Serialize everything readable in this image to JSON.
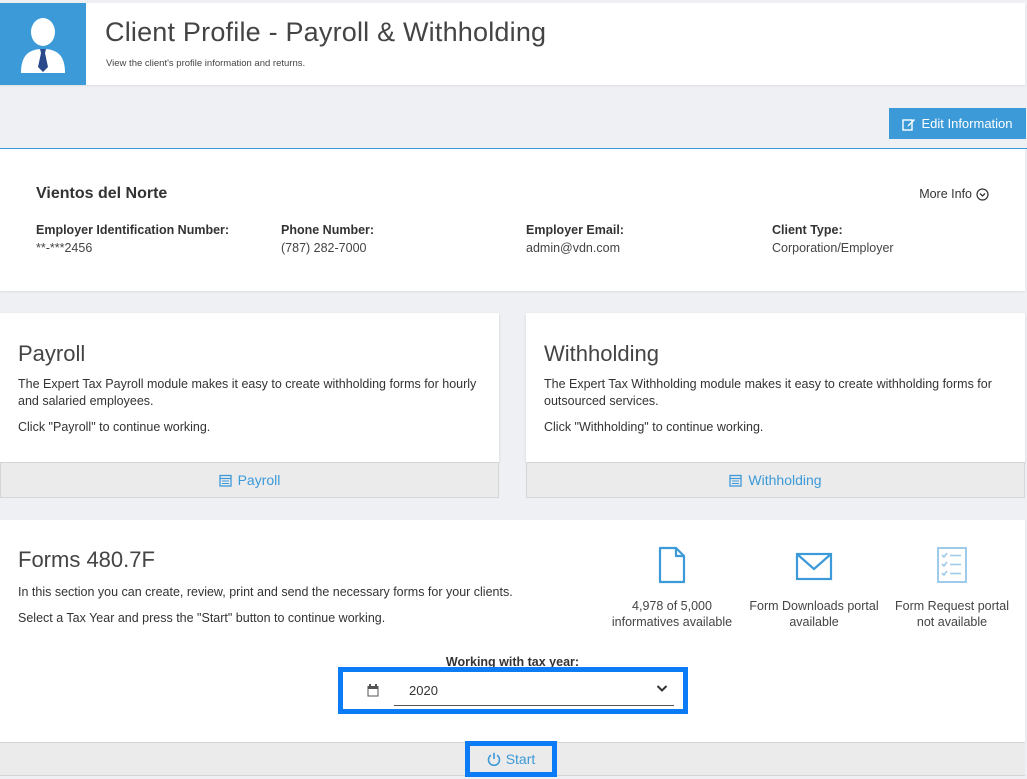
{
  "header": {
    "title": "Client Profile - Payroll & Withholding",
    "subtitle": "View the client's profile information and returns."
  },
  "toolbar": {
    "edit_label": "Edit Information"
  },
  "client": {
    "name": "Vientos del Norte",
    "more_info_label": "More Info",
    "fields": [
      {
        "label": "Employer Identification Number:",
        "value": "**-***2456"
      },
      {
        "label": "Phone Number:",
        "value": "(787) 282-7000"
      },
      {
        "label": "Employer Email:",
        "value": "admin@vdn.com"
      },
      {
        "label": "Client Type:",
        "value": "Corporation/Employer"
      }
    ]
  },
  "modules": {
    "payroll": {
      "title": "Payroll",
      "description": "The Expert Tax Payroll module makes it easy to create withholding forms for hourly and salaried employees.",
      "hint": "Click \"Payroll\" to continue working.",
      "button_label": "Payroll"
    },
    "withholding": {
      "title": "Withholding",
      "description": "The Expert Tax Withholding module makes it easy to create withholding forms for outsourced services.",
      "hint": "Click \"Withholding\" to continue working.",
      "button_label": "Withholding"
    }
  },
  "forms": {
    "title": "Forms 480.7F",
    "description1": "In this section you can create, review, print and send the necessary forms for your clients.",
    "description2": "Select a Tax Year and press the \"Start\" button to continue working.",
    "stats": [
      {
        "icon": "document-icon",
        "line1": "4,978 of 5,000",
        "line2": "informatives available"
      },
      {
        "icon": "envelope-icon",
        "line1": "Form Downloads portal",
        "line2": "available"
      },
      {
        "icon": "checklist-icon",
        "line1": "Form Request portal",
        "line2": "not available"
      }
    ],
    "year_label": "Working with tax year:",
    "year_value": "2020",
    "start_label": "Start"
  },
  "colors": {
    "accent": "#3c9ad9",
    "highlight": "#0b7cf5"
  }
}
